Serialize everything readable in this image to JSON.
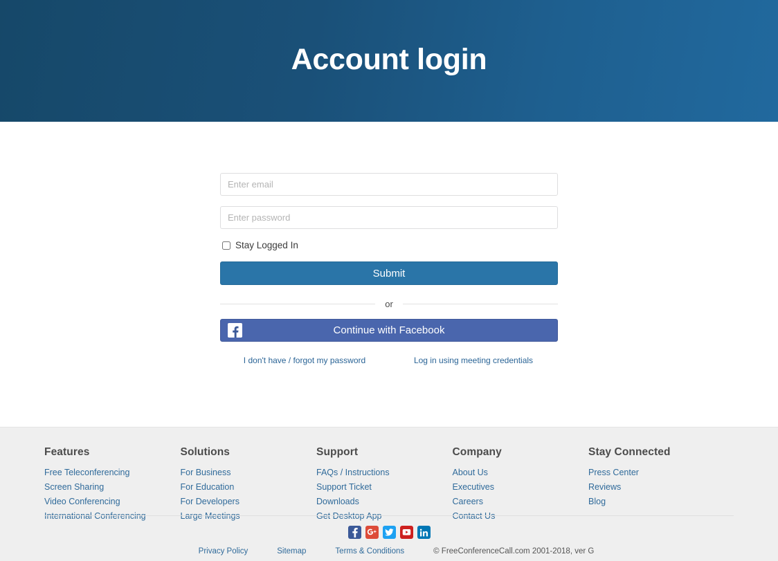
{
  "hero": {
    "title": "Account login",
    "gradient_from": "#164869",
    "gradient_to": "#21699e"
  },
  "form": {
    "email": {
      "value": "",
      "placeholder": "Enter email"
    },
    "password": {
      "value": "",
      "placeholder": "Enter password"
    },
    "stay_logged_in_label": "Stay Logged In",
    "stay_logged_in_checked": false,
    "submit_label": "Submit",
    "or_label": "or",
    "facebook_label": "Continue with Facebook",
    "facebook_color": "#4a66ad",
    "submit_color": "#2a75a8",
    "forgot_password_link": "I don't have / forgot my password",
    "meeting_credentials_link": "Log in using meeting credentials"
  },
  "footer": {
    "columns": [
      {
        "heading": "Features",
        "links": [
          "Free Teleconferencing",
          "Screen Sharing",
          "Video Conferencing",
          "International Conferencing"
        ]
      },
      {
        "heading": "Solutions",
        "links": [
          "For Business",
          "For Education",
          "For Developers",
          "Large Meetings"
        ]
      },
      {
        "heading": "Support",
        "links": [
          "FAQs / Instructions",
          "Support Ticket",
          "Downloads",
          "Get Desktop App"
        ]
      },
      {
        "heading": "Company",
        "links": [
          "About Us",
          "Executives",
          "Careers",
          "Contact Us"
        ]
      },
      {
        "heading": "Stay Connected",
        "links": [
          "Press Center",
          "Reviews",
          "Blog"
        ]
      }
    ],
    "social": [
      {
        "name": "facebook-icon",
        "color": "#3b5998"
      },
      {
        "name": "google-plus-icon",
        "color": "#dd4b39"
      },
      {
        "name": "twitter-icon",
        "color": "#1da1f2"
      },
      {
        "name": "youtube-icon",
        "color": "#cd201f"
      },
      {
        "name": "linkedin-icon",
        "color": "#0077b5"
      }
    ],
    "bottom_links": [
      "Privacy Policy",
      "Sitemap",
      "Terms & Conditions"
    ],
    "copyright": "© FreeConferenceCall.com 2001-2018, ver G"
  }
}
